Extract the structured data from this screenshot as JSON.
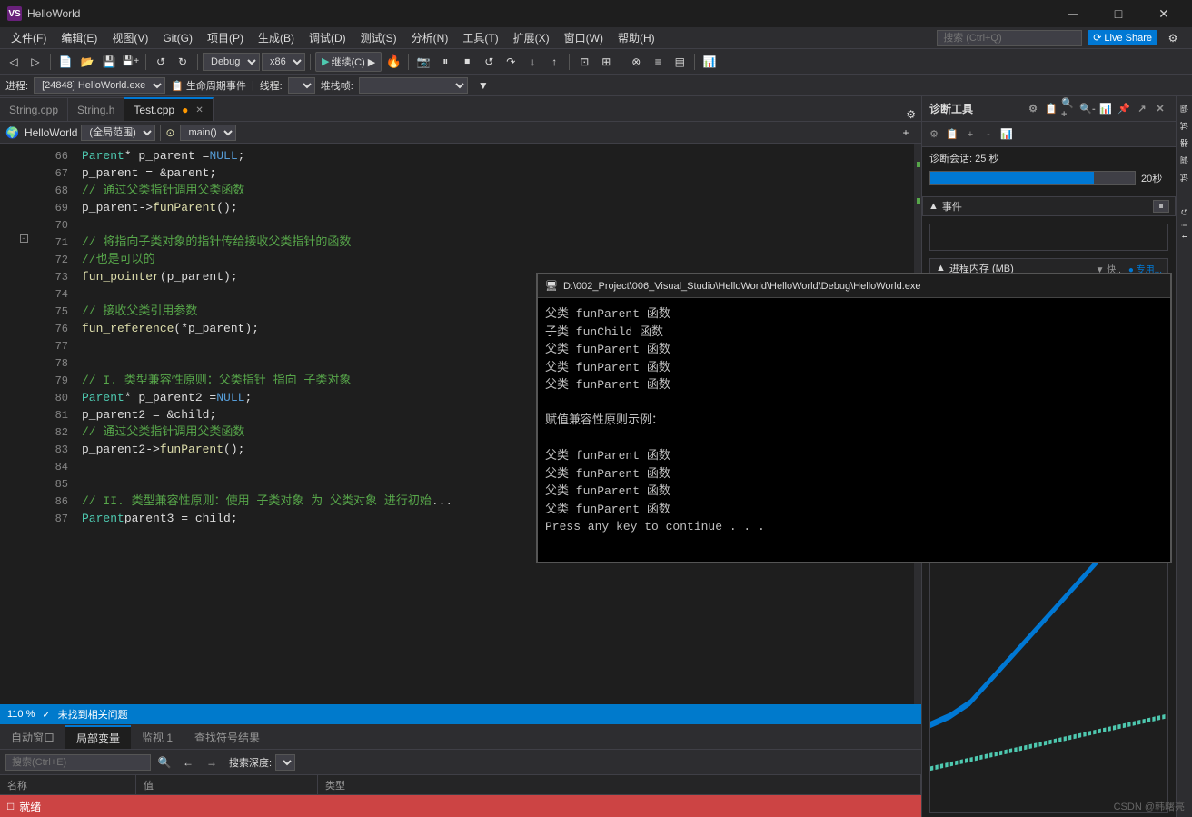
{
  "titlebar": {
    "icon": "VS",
    "title": "HelloWorld",
    "min_label": "─",
    "max_label": "□",
    "close_label": "✕"
  },
  "menubar": {
    "items": [
      {
        "label": "文件(F)"
      },
      {
        "label": "编辑(E)"
      },
      {
        "label": "视图(V)"
      },
      {
        "label": "Git(G)"
      },
      {
        "label": "项目(P)"
      },
      {
        "label": "生成(B)"
      },
      {
        "label": "调试(D)"
      },
      {
        "label": "测试(S)"
      },
      {
        "label": "分析(N)"
      },
      {
        "label": "工具(T)"
      },
      {
        "label": "扩展(X)"
      },
      {
        "label": "窗口(W)"
      },
      {
        "label": "帮助(H)"
      }
    ],
    "search_placeholder": "搜索 (Ctrl+Q)",
    "live_share": "Live Share"
  },
  "toolbar": {
    "debug_config": "Debug",
    "platform": "x86",
    "continue_label": "继续(C) ▶",
    "fire_icon": "🔥"
  },
  "process_bar": {
    "label": "进程:",
    "process": "[24848] HelloWorld.exe",
    "lifecycle": "生命周期事件",
    "thread_label": "线程:",
    "find_label": "堆栈帧:"
  },
  "tabs": [
    {
      "label": "String.cpp",
      "active": false,
      "dirty": false
    },
    {
      "label": "String.h",
      "active": false,
      "dirty": false
    },
    {
      "label": "Test.cpp",
      "active": true,
      "dirty": true
    }
  ],
  "editor_toolbar": {
    "scope": "(全局范围)",
    "method": "main()"
  },
  "code_lines": [
    {
      "num": 66,
      "content": "    Parent* p_parent = NULL;",
      "type": "plain",
      "bp": false,
      "fold": false
    },
    {
      "num": 67,
      "content": "    p_parent = &parent;",
      "type": "plain",
      "bp": false,
      "fold": false
    },
    {
      "num": 68,
      "content": "    // 通过父类指针调用父类函数",
      "type": "comment",
      "bp": false,
      "fold": false
    },
    {
      "num": 69,
      "content": "    p_parent->funParent();",
      "type": "plain",
      "bp": false,
      "fold": false
    },
    {
      "num": 70,
      "content": "",
      "type": "plain",
      "bp": false,
      "fold": false
    },
    {
      "num": 71,
      "content": "    // 将指向子类对象的指针传给接收父类指针的函数",
      "type": "comment",
      "bp": false,
      "fold": true
    },
    {
      "num": 72,
      "content": "    //也是可以的",
      "type": "comment",
      "bp": false,
      "fold": false
    },
    {
      "num": 73,
      "content": "    fun_pointer(p_parent);",
      "type": "plain",
      "bp": false,
      "fold": false
    },
    {
      "num": 74,
      "content": "",
      "type": "plain",
      "bp": false,
      "fold": false
    },
    {
      "num": 75,
      "content": "    // 接收父类引用参数",
      "type": "comment",
      "bp": false,
      "fold": false
    },
    {
      "num": 76,
      "content": "    fun_reference(*p_parent);",
      "type": "plain",
      "bp": false,
      "fold": false
    },
    {
      "num": 77,
      "content": "",
      "type": "plain",
      "bp": false,
      "fold": false
    },
    {
      "num": 78,
      "content": "",
      "type": "plain",
      "bp": false,
      "fold": false
    },
    {
      "num": 79,
      "content": "    // I. 类型兼容性原则：父类指针 指向 子类对象",
      "type": "comment",
      "bp": false,
      "fold": false
    },
    {
      "num": 80,
      "content": "    Parent* p_parent2 = NULL;",
      "type": "plain",
      "bp": false,
      "fold": false
    },
    {
      "num": 81,
      "content": "    p_parent2 = &child;",
      "type": "plain",
      "bp": false,
      "fold": false
    },
    {
      "num": 82,
      "content": "    // 通过父类指针调用父类函数",
      "type": "comment",
      "bp": false,
      "fold": false
    },
    {
      "num": 83,
      "content": "    p_parent2->funParent();",
      "type": "plain",
      "bp": false,
      "fold": false
    },
    {
      "num": 84,
      "content": "",
      "type": "plain",
      "bp": false,
      "fold": false
    },
    {
      "num": 85,
      "content": "",
      "type": "plain",
      "bp": false,
      "fold": false
    },
    {
      "num": 86,
      "content": "    // II. 类型兼容性原则：使用 子类对象 为 父类对象 进行初始...",
      "type": "comment",
      "bp": false,
      "fold": false
    },
    {
      "num": 87,
      "content": "    Parent parent3 = child;",
      "type": "plain",
      "bp": false,
      "fold": false
    }
  ],
  "status_bar": {
    "zoom": "110 %",
    "no_issues": "✓ 未找到相关问题"
  },
  "bottom_tabs": [
    {
      "label": "自动窗口",
      "active": false
    },
    {
      "label": "局部变量",
      "active": true
    },
    {
      "label": "监视 1",
      "active": false
    },
    {
      "label": "查找符号结果",
      "active": false
    }
  ],
  "locals_panel": {
    "search_placeholder": "搜索(Ctrl+E)",
    "search_depth_label": "搜索深度:",
    "cols": [
      "名称",
      "值",
      "类型"
    ],
    "rows": []
  },
  "ready_label": "就绪",
  "diagnostics": {
    "title": "诊断工具",
    "session_label": "诊断会话: 25 秒",
    "time_value": "20秒",
    "time_bar_pct": 80,
    "events_label": "▲ 事件",
    "memory_label": "▲ 进程内存 (MB)",
    "fast_label": "▼ 快..",
    "used_label": "● 专用..."
  },
  "console": {
    "title": "D:\\002_Project\\006_Visual_Studio\\HelloWorld\\HelloWorld\\Debug\\HelloWorld.exe",
    "lines": [
      "父类  funParent 函数",
      "子类  funChild 函数",
      "父类  funParent 函数",
      "父类  funParent 函数",
      "父类  funParent 函数",
      "",
      "赋值兼容性原则示例：",
      "",
      "父类  funParent 函数",
      "父类  funParent 函数",
      "父类  funParent 函数",
      "父类  funParent 函数",
      "Press any key to continue . . ."
    ]
  },
  "watermark": "CSDN @韩曙亮"
}
